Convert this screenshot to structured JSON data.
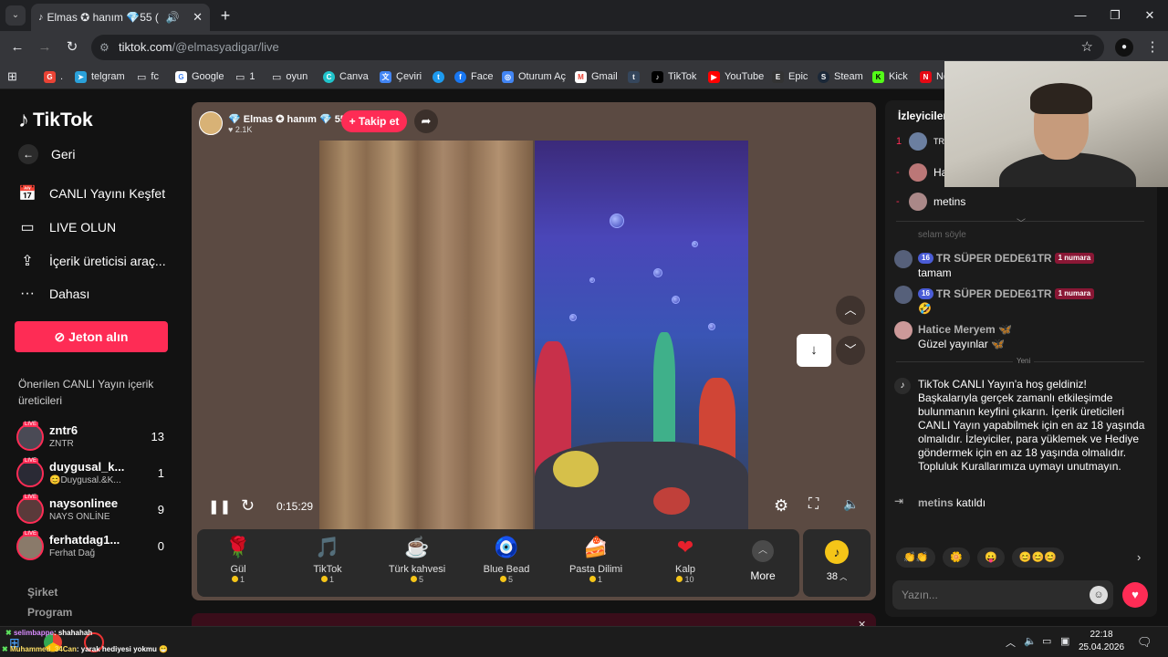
{
  "browser": {
    "tab_title": "Elmas ✪ hanım 💎55 (",
    "url_domain": "tiktok.com",
    "url_path": "/@elmasyadigar/live",
    "bookmarks": [
      "telgram",
      "fc",
      "Google",
      "1",
      "oyun",
      "Canva",
      "Çeviri",
      "Face",
      "Oturum Aç",
      "Gmail",
      "TikTok",
      "YouTube",
      "Epic",
      "Steam",
      "Kick",
      "Ne"
    ]
  },
  "sidebar": {
    "logo": "TikTok",
    "back": "Geri",
    "nav": [
      "CANLI Yayını Keşfet",
      "LIVE OLUN",
      "İçerik üreticisi araç...",
      "Dahası"
    ],
    "jeton_button": "Jeton alın",
    "suggested_title": "Önerilen CANLI Yayın içerik üreticileri",
    "creators": [
      {
        "name": "zntr6",
        "sub": "ZNTR",
        "count": "13"
      },
      {
        "name": "duygusal_k...",
        "sub": "😊Duygusal.&K...",
        "count": "1"
      },
      {
        "name": "naysonlinee",
        "sub": "NAYS ONLİNE",
        "count": "9"
      },
      {
        "name": "ferhatdag1...",
        "sub": "Ferhat Dağ",
        "count": "0"
      }
    ],
    "footer": [
      "Şirket",
      "Program"
    ]
  },
  "player": {
    "streamer_name": "💎 Elmas ✪ hanım 💎 55",
    "likes": "♥ 2.1K",
    "follow_button": "+ Takip et",
    "timer": "0:15:29"
  },
  "gifts": [
    {
      "name": "Gül",
      "price": "1",
      "icon": "🌹"
    },
    {
      "name": "TikTok",
      "price": "1",
      "icon": "🎵"
    },
    {
      "name": "Türk kahvesi",
      "price": "5",
      "icon": "☕"
    },
    {
      "name": "Blue Bead",
      "price": "5",
      "icon": "🧿"
    },
    {
      "name": "Pasta Dilimi",
      "price": "1",
      "icon": "🍰"
    },
    {
      "name": "Kalp",
      "price": "10",
      "icon": "❤"
    }
  ],
  "gift_more": "More",
  "coin_balance": "38",
  "chat": {
    "viewers_title": "İzleyiciler",
    "viewers": [
      {
        "rank": "1",
        "name": "TR"
      },
      {
        "rank": "-",
        "name": "Ha"
      },
      {
        "rank": "-",
        "name": "metins"
      }
    ],
    "faded_text": "selam söyle",
    "messages": [
      {
        "level": "16",
        "name": "TR SÜPER DEDE61TR",
        "badge": "1 numara",
        "text": "tamam"
      },
      {
        "level": "16",
        "name": "TR SÜPER DEDE61TR",
        "badge": "1 numara",
        "text": "🤣"
      },
      {
        "name": "Hatice Meryem 🦋",
        "text": "Güzel yayınlar 🦋"
      }
    ],
    "new_label": "Yeni",
    "welcome": "TikTok CANLI Yayın'a hoş geldiniz! Başkalarıyla gerçek zamanlı etkileşimde bulunmanın keyfini çıkarın. İçerik üreticileri CANLI Yayın yapabilmek için en az 18 yaşında olmalıdır. İzleyiciler, para yüklemek ve Hediye göndermek için en az 18 yaşında olmalıdır. Topluluk Kurallarımıza uymayı unutmayın.",
    "joined_name": "metins",
    "joined_text": "katıldı",
    "quick_emojis": [
      "👏👏",
      "🌼",
      "😛",
      "😊😊😊"
    ],
    "input_placeholder": "Yazın..."
  },
  "overlay": {
    "line1_user": "selimbappe",
    "line1_text": ": shahahah",
    "line2_user": "Muhammed_34Can",
    "line2_text": ": yarak hediyesi yokmu 😁"
  },
  "clock": {
    "time": "22:18",
    "date": "25.04.2026"
  }
}
